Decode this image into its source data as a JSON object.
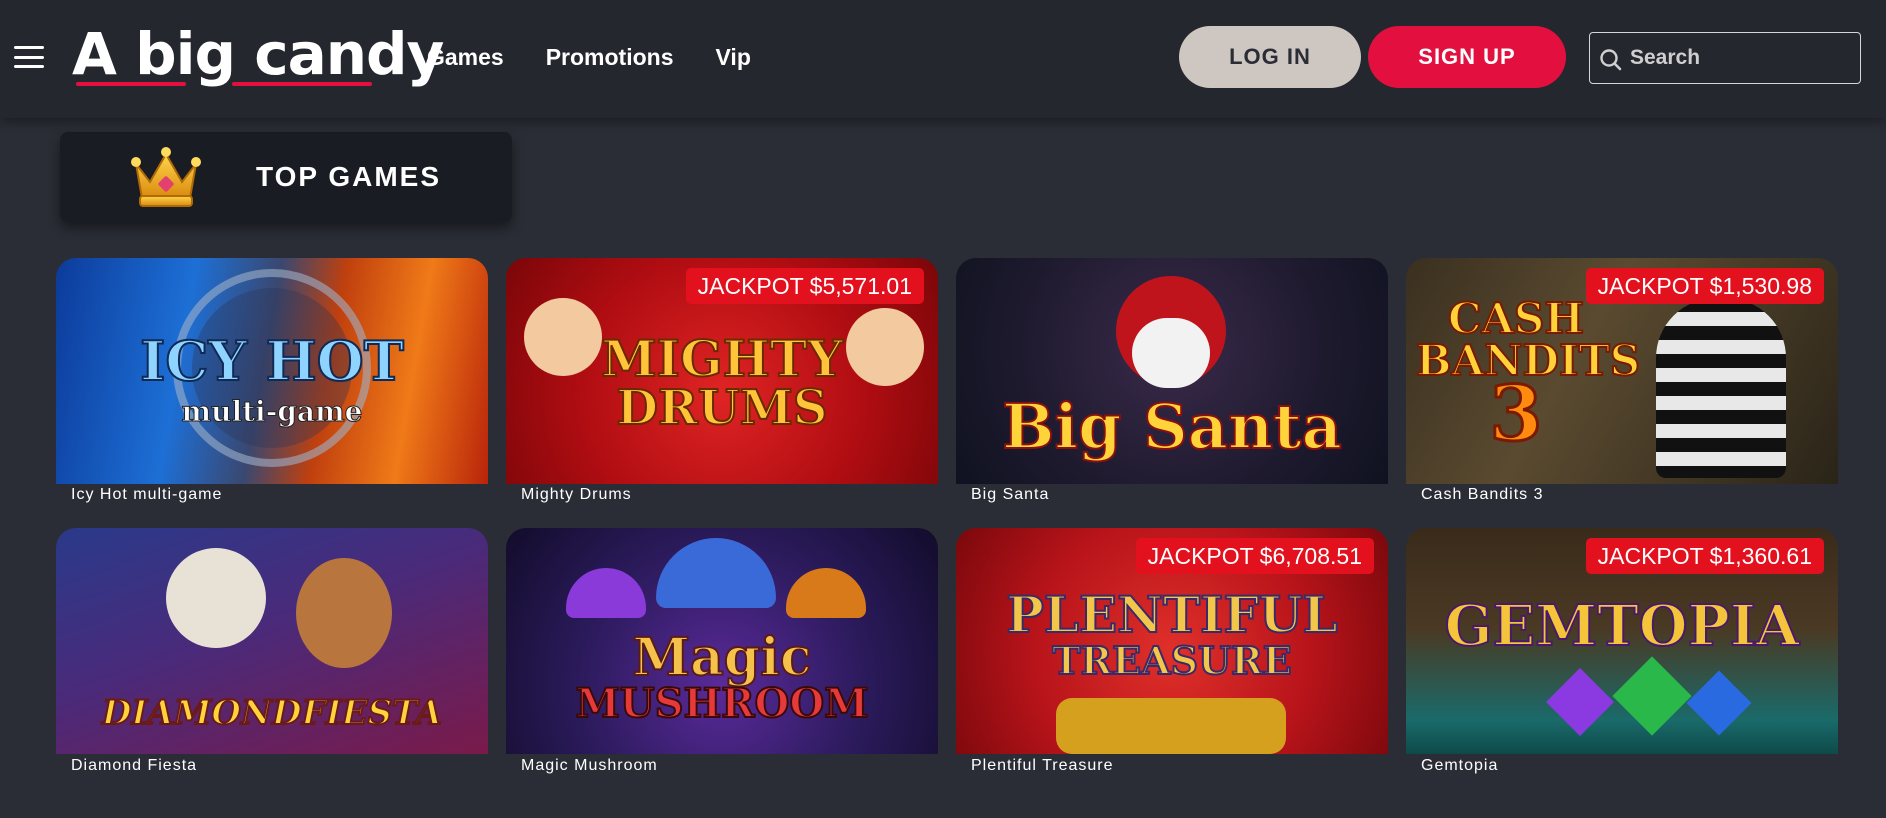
{
  "header": {
    "logo_a": "A",
    "logo_big": "big",
    "logo_candy": "candy",
    "nav": [
      "Games",
      "Promotions",
      "Vip"
    ],
    "login_label": "LOG IN",
    "signup_label": "SIGN UP",
    "search_placeholder": "Search"
  },
  "section": {
    "title": "TOP GAMES",
    "icon": "crown-icon"
  },
  "games": [
    {
      "name": "Icy Hot multi-game",
      "jackpot": "",
      "art_title": "ICY HOT",
      "art_sub": "multi-game"
    },
    {
      "name": "Mighty Drums",
      "jackpot": "JACKPOT $5,571.01",
      "art_title": "MIGHTY",
      "art_sub": "DRUMS"
    },
    {
      "name": "Big Santa",
      "jackpot": "",
      "art_title": "Big Santa",
      "art_sub": ""
    },
    {
      "name": "Cash Bandits 3",
      "jackpot": "JACKPOT $1,530.98",
      "art_title": "CASH BANDITS",
      "art_sub": "3"
    },
    {
      "name": "Diamond Fiesta",
      "jackpot": "",
      "art_title": "DIAMONDFIESTA",
      "art_sub": ""
    },
    {
      "name": "Magic Mushroom",
      "jackpot": "",
      "art_title": "Magic",
      "art_sub": "MUSHROOM"
    },
    {
      "name": "Plentiful Treasure",
      "jackpot": "JACKPOT $6,708.51",
      "art_title": "PLENTIFUL",
      "art_sub": "TREASURE"
    },
    {
      "name": "Gemtopia",
      "jackpot": "JACKPOT $1,360.61",
      "art_title": "GEMTOPIA",
      "art_sub": ""
    }
  ],
  "colors": {
    "accent": "#e3103f",
    "jackpot": "#e3101e",
    "background": "#2b2d36",
    "header": "#25272e"
  }
}
